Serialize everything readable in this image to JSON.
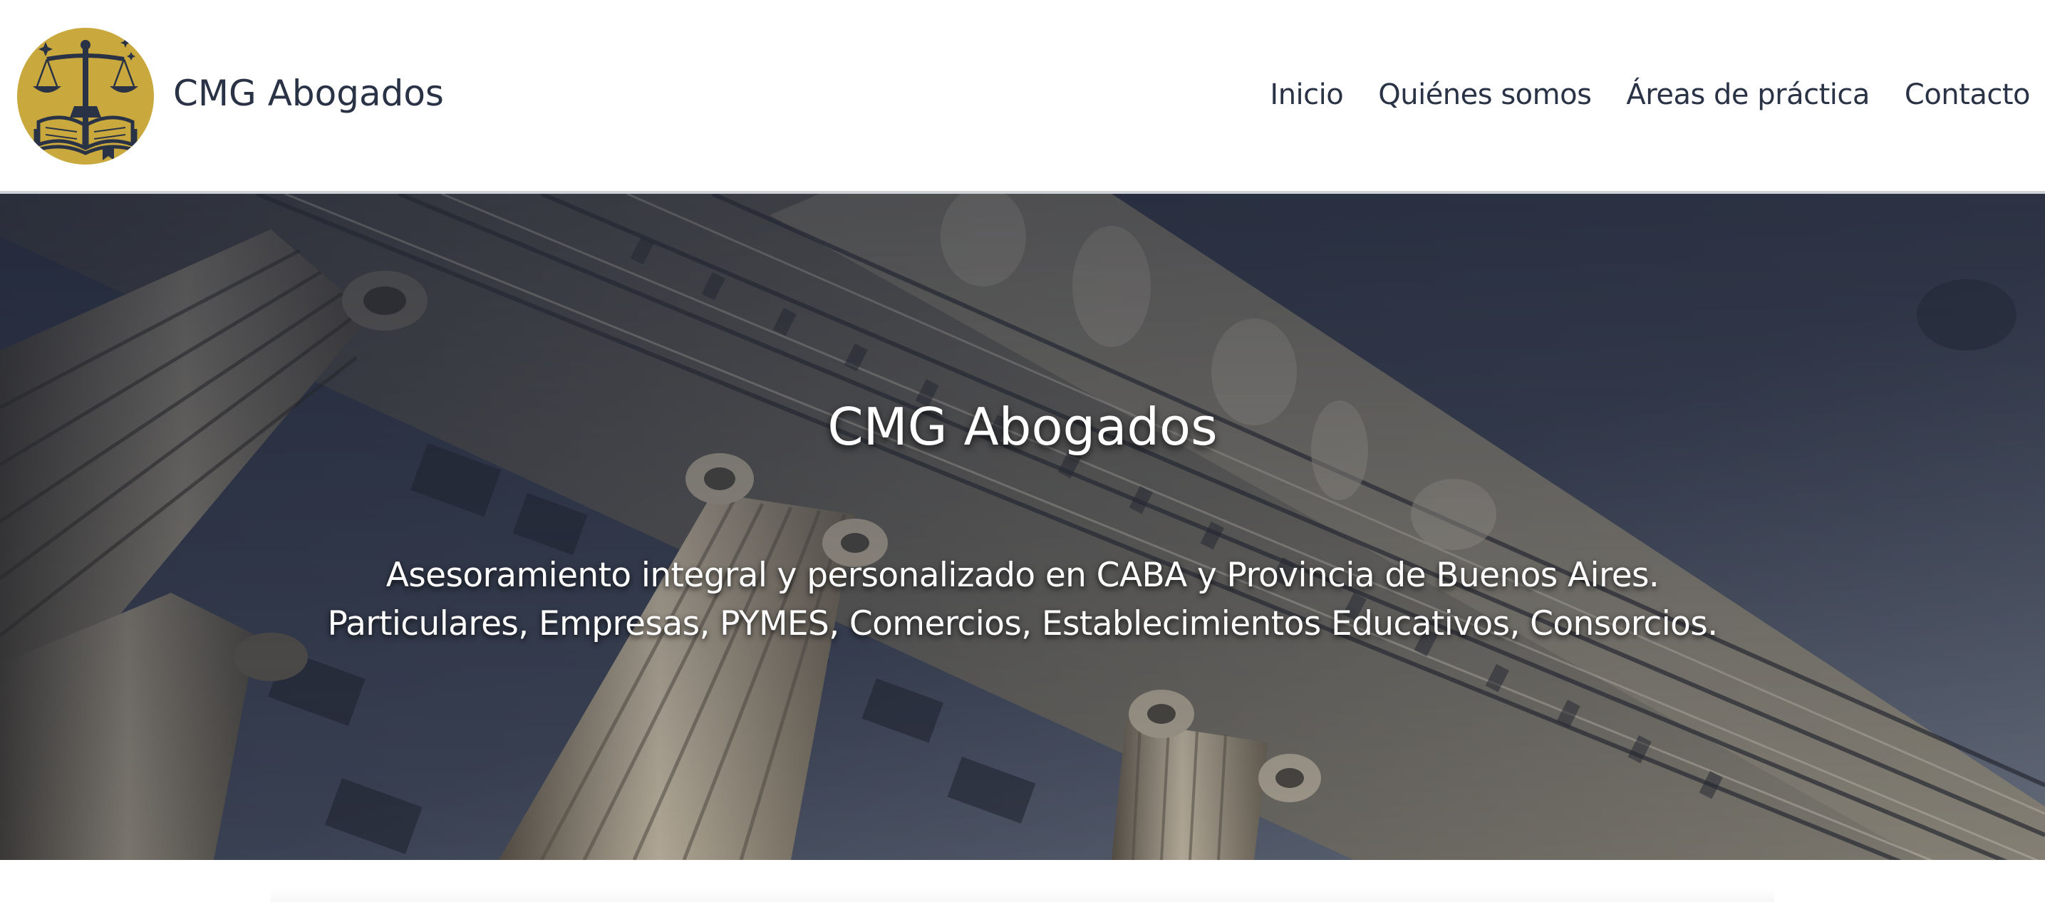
{
  "header": {
    "brand_name": "CMG Abogados",
    "logo_icon": "scales-of-justice-book-icon"
  },
  "nav": {
    "items": [
      {
        "label": "Inicio"
      },
      {
        "label": "Quiénes somos"
      },
      {
        "label": "Áreas de práctica"
      },
      {
        "label": "Contacto"
      }
    ]
  },
  "hero": {
    "title": "CMG Abogados",
    "subtitle_line1": "Asesoramiento integral y personalizado en CABA y Provincia de Buenos Aires.",
    "subtitle_line2": "Particulares, Empresas, PYMES, Comercios, Establecimientos Educativos, Consorcios.",
    "background": "neoclassical-building-columns-photo"
  },
  "colors": {
    "brand_gold": "#c9a83d",
    "text_dark": "#2a3346",
    "hero_overlay": "#2b3244",
    "white": "#ffffff"
  }
}
